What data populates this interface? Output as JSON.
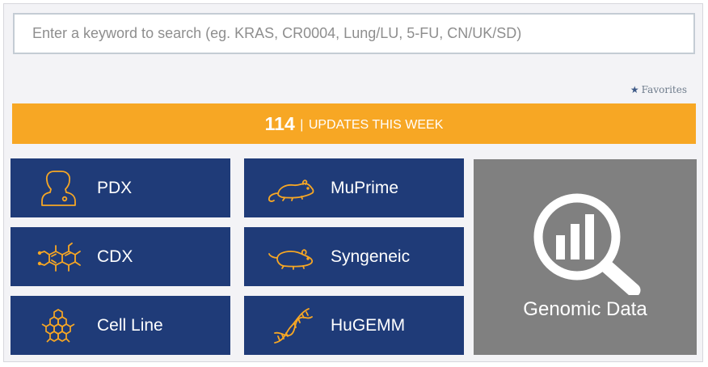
{
  "search": {
    "placeholder": "Enter a keyword to search (eg. KRAS, CR0004, Lung/LU, 5-FU, CN/UK/SD)"
  },
  "favorites": {
    "label": "Favorites",
    "icon": "star-icon"
  },
  "updates": {
    "count": "114",
    "separator": "|",
    "label": "UPDATES THIS WEEK"
  },
  "tiles": [
    {
      "label": "PDX",
      "icon": "person-bust-icon"
    },
    {
      "label": "MuPrime",
      "icon": "mouse-icon"
    },
    {
      "label": "CDX",
      "icon": "molecule-icon"
    },
    {
      "label": "Syngeneic",
      "icon": "mouse-icon"
    },
    {
      "label": "Cell Line",
      "icon": "honeycomb-cells-icon"
    },
    {
      "label": "HuGEMM",
      "icon": "dna-helix-icon"
    }
  ],
  "genomic": {
    "label": "Genomic Data",
    "icon": "magnifier-bar-chart-icon"
  },
  "colors": {
    "tile_bg": "#1f3b78",
    "icon_accent": "#f7a724",
    "banner_bg": "#f7a724",
    "genomic_bg": "#808080"
  }
}
